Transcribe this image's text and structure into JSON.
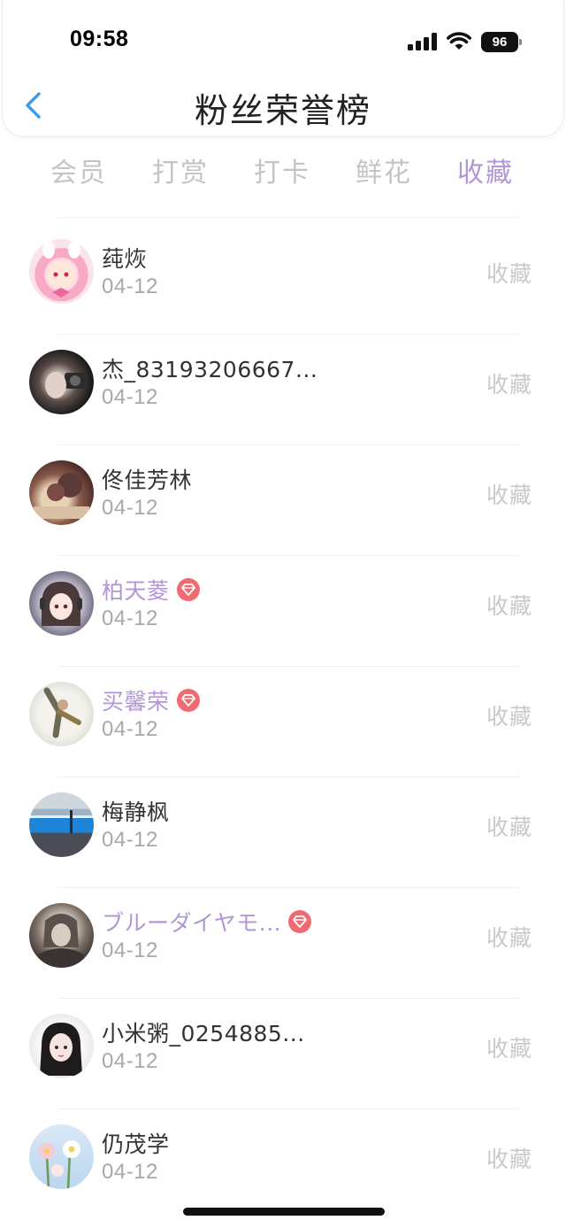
{
  "status_bar": {
    "time": "09:58",
    "battery": "96"
  },
  "header": {
    "title": "粉丝荣誉榜"
  },
  "tabs": [
    {
      "label": "会员",
      "active": false
    },
    {
      "label": "打赏",
      "active": false
    },
    {
      "label": "打卡",
      "active": false
    },
    {
      "label": "鲜花",
      "active": false
    },
    {
      "label": "收藏",
      "active": true
    }
  ],
  "fans": [
    {
      "name": "莼烣",
      "date": "04-12",
      "action": "收藏",
      "vip": false
    },
    {
      "name": "杰_83193206667...",
      "date": "04-12",
      "action": "收藏",
      "vip": false
    },
    {
      "name": "佟佳芳林",
      "date": "04-12",
      "action": "收藏",
      "vip": false
    },
    {
      "name": "柏天菱",
      "date": "04-12",
      "action": "收藏",
      "vip": true
    },
    {
      "name": "买馨荣",
      "date": "04-12",
      "action": "收藏",
      "vip": true
    },
    {
      "name": "梅静枫",
      "date": "04-12",
      "action": "收藏",
      "vip": false
    },
    {
      "name": "ブルーダイヤモ...",
      "date": "04-12",
      "action": "收藏",
      "vip": true
    },
    {
      "name": "小米粥_0254885...",
      "date": "04-12",
      "action": "收藏",
      "vip": false
    },
    {
      "name": "仍茂学",
      "date": "04-12",
      "action": "收藏",
      "vip": false
    }
  ],
  "colors": {
    "accent": "#b396d6",
    "back_arrow": "#3a9be8",
    "vip_badge": "#f06a72",
    "inactive_tab": "#c4c4c4"
  }
}
